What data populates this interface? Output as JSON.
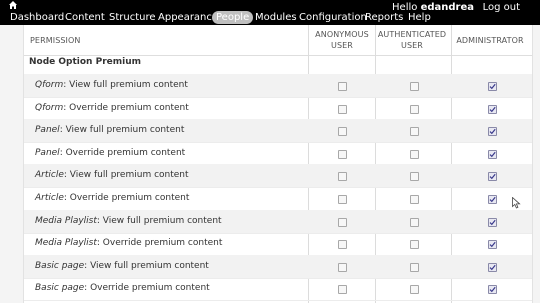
{
  "toolbar": {
    "menu": [
      {
        "label": "Dashboard",
        "active": false
      },
      {
        "label": "Content",
        "active": false
      },
      {
        "label": "Structure",
        "active": false
      },
      {
        "label": "Appearance",
        "active": false
      },
      {
        "label": "People",
        "active": true
      },
      {
        "label": "Modules",
        "active": false
      },
      {
        "label": "Configuration",
        "active": false
      },
      {
        "label": "Reports",
        "active": false
      },
      {
        "label": "Help",
        "active": false
      }
    ],
    "hello": "Hello",
    "username": "edandrea",
    "logout": "Log out"
  },
  "table": {
    "headers": {
      "permission": "PERMISSION",
      "anonymous": "ANONYMOUS USER",
      "authenticated": "AUTHENTICATED USER",
      "administrator": "ADMINISTRATOR"
    },
    "module": "Node Option Premium",
    "rows": [
      {
        "type": "Qform",
        "text": ": View full premium content",
        "anonymous": false,
        "authenticated": false,
        "administrator": true
      },
      {
        "type": "Qform",
        "text": ": Override premium content",
        "anonymous": false,
        "authenticated": false,
        "administrator": true
      },
      {
        "type": "Panel",
        "text": ": View full premium content",
        "anonymous": false,
        "authenticated": false,
        "administrator": true
      },
      {
        "type": "Panel",
        "text": ": Override premium content",
        "anonymous": false,
        "authenticated": false,
        "administrator": true
      },
      {
        "type": "Article",
        "text": ": View full premium content",
        "anonymous": false,
        "authenticated": false,
        "administrator": true
      },
      {
        "type": "Article",
        "text": ": Override premium content",
        "anonymous": false,
        "authenticated": false,
        "administrator": true
      },
      {
        "type": "Media Playlist",
        "text": ": View full premium content",
        "anonymous": false,
        "authenticated": false,
        "administrator": true
      },
      {
        "type": "Media Playlist",
        "text": ": Override premium content",
        "anonymous": false,
        "authenticated": false,
        "administrator": true
      },
      {
        "type": "Basic page",
        "text": ": View full premium content",
        "anonymous": false,
        "authenticated": false,
        "administrator": true
      },
      {
        "type": "Basic page",
        "text": ": Override premium content",
        "anonymous": false,
        "authenticated": false,
        "administrator": true
      }
    ]
  },
  "colors": {
    "toolbar_bg": "#000000",
    "active_tab_bg": "#bfbfbf",
    "row_alt_bg": "#f2f2f2"
  }
}
